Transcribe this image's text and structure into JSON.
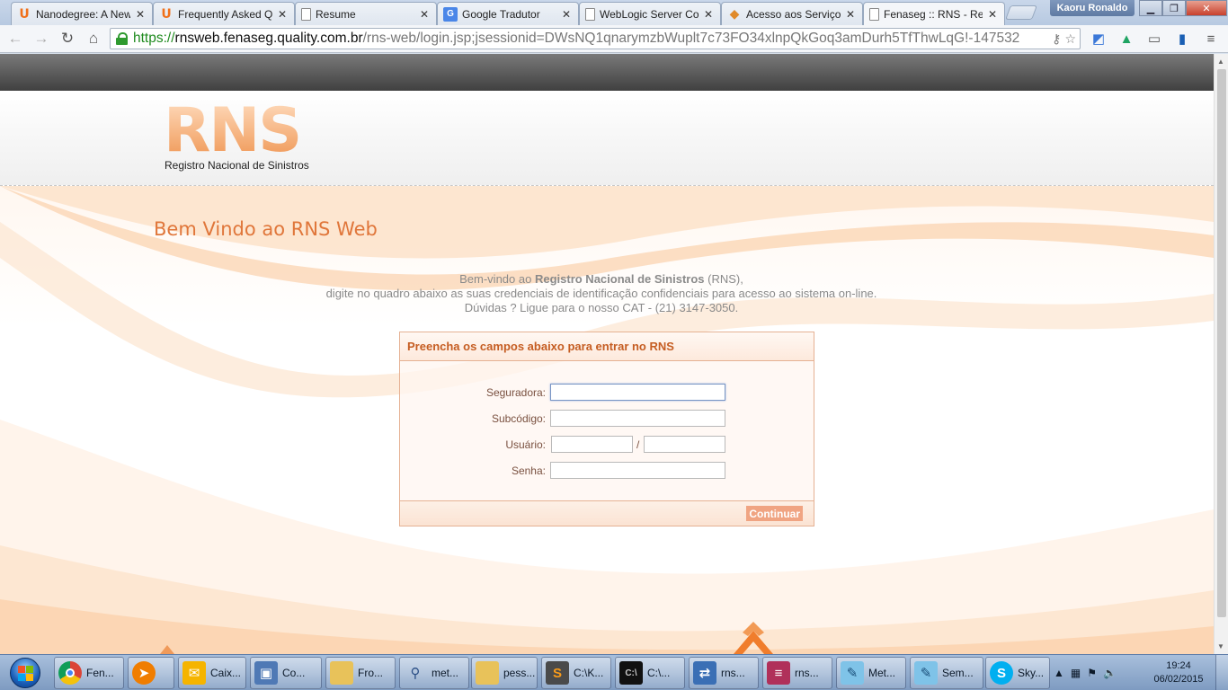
{
  "browser": {
    "tabs": [
      {
        "title": "Nanodegree: A New",
        "icon": "udacity-icon"
      },
      {
        "title": "Frequently Asked Q",
        "icon": "udacity-icon"
      },
      {
        "title": "Resume",
        "icon": "document-icon"
      },
      {
        "title": "Google Tradutor",
        "icon": "google-translate-icon"
      },
      {
        "title": "WebLogic Server Co",
        "icon": "document-icon"
      },
      {
        "title": "Acesso aos Serviços",
        "icon": "acesso-icon"
      },
      {
        "title": "Fenaseg :: RNS - Re",
        "icon": "document-icon",
        "active": true
      }
    ],
    "close_glyph": "✕",
    "user_name": "Kaoru Ronaldo",
    "url": {
      "scheme": "https://",
      "host": "rnsweb.fenaseg.quality.com.br",
      "path": "/rns-web/login.jsp;jsessionid=DWsNQ1qnarymzbWuplt7c73FO34xlnpQkGoq3amDurh5TfThwLqG!-147532"
    }
  },
  "page": {
    "logo_text": "RNS",
    "logo_subtitle": "Registro Nacional de Sinistros",
    "welcome_title": "Bem Vindo ao RNS Web",
    "intro": {
      "line1_prefix": "Bem-vindo ao",
      "line1_bold": "Registro Nacional de Sinistros",
      "line1_suffix": "(RNS),",
      "line2": "digite no quadro abaixo as suas credenciais de identificação confidenciais para acesso ao sistema on-line.",
      "line3": "Dúvidas ? Ligue para o nosso CAT - (21) 3147-3050."
    },
    "login": {
      "heading": "Preencha os campos abaixo para entrar no RNS",
      "seguradora_label": "Seguradora:",
      "seguradora_value": "",
      "subcodigo_label": "Subcódigo:",
      "subcodigo_value": "",
      "usuario_label": "Usuário:",
      "usuario_value_1": "",
      "usuario_separator": "/",
      "usuario_value_2": "",
      "senha_label": "Senha:",
      "senha_value": "",
      "submit_label": "Continuar"
    }
  },
  "taskbar": {
    "items": [
      {
        "label": "Fen...",
        "icon": "chrome-icon"
      },
      {
        "label": "",
        "icon": "media-player-icon"
      },
      {
        "label": "Caix...",
        "icon": "outlook-icon"
      },
      {
        "label": "Co...",
        "icon": "computer-icon"
      },
      {
        "label": "Fro...",
        "icon": "folder-icon"
      },
      {
        "label": "met...",
        "icon": "search-tool-icon"
      },
      {
        "label": "pess...",
        "icon": "folder-icon"
      },
      {
        "label": "C:\\K...",
        "icon": "sublime-icon"
      },
      {
        "label": "C:\\...",
        "icon": "cmd-icon"
      },
      {
        "label": "rns...",
        "icon": "network-icon"
      },
      {
        "label": "rns...",
        "icon": "database-icon"
      },
      {
        "label": "Met...",
        "icon": "notepad-icon"
      },
      {
        "label": "Sem...",
        "icon": "notepad-icon"
      },
      {
        "label": "Sky...",
        "icon": "skype-icon"
      }
    ],
    "clock_time": "19:24",
    "clock_date": "06/02/2015"
  },
  "colors": {
    "brand_orange": "#e0763a",
    "heading_orange": "#c55d22",
    "button_orange": "#f0a482",
    "url_secure_green": "#1e8a1e"
  }
}
